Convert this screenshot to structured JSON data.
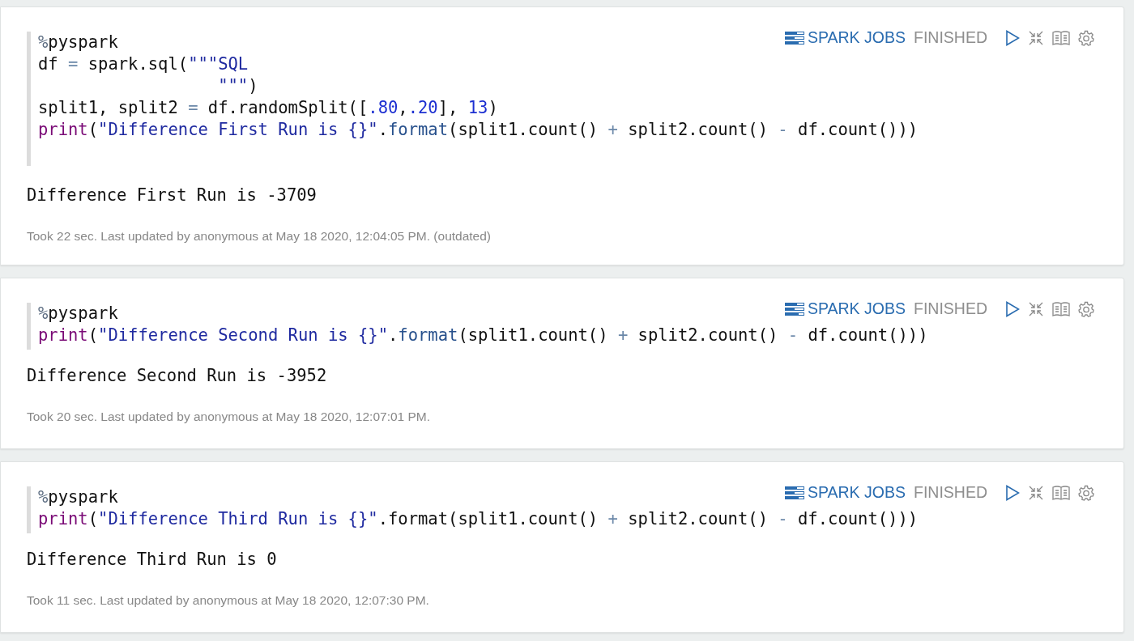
{
  "paragraphs": [
    {
      "toolbar": {
        "jobs_label": "SPARK JOBS",
        "status": "FINISHED"
      },
      "code": [
        [
          {
            "kind": "magic",
            "text": "%"
          },
          {
            "kind": "plain",
            "text": "pyspark"
          }
        ],
        [
          {
            "kind": "plain",
            "text": "df "
          },
          {
            "kind": "operator",
            "text": "="
          },
          {
            "kind": "plain",
            "text": " spark.sql("
          },
          {
            "kind": "string",
            "text": "\"\"\"SQL"
          }
        ],
        [
          {
            "kind": "string",
            "text": "                  \"\"\""
          },
          {
            "kind": "plain",
            "text": ")"
          }
        ],
        [
          {
            "kind": "plain",
            "text": "split1, split2 "
          },
          {
            "kind": "operator",
            "text": "="
          },
          {
            "kind": "plain",
            "text": " df.randomSplit(["
          },
          {
            "kind": "number",
            "text": ".80"
          },
          {
            "kind": "plain",
            "text": ","
          },
          {
            "kind": "number",
            "text": ".20"
          },
          {
            "kind": "plain",
            "text": "], "
          },
          {
            "kind": "number",
            "text": "13"
          },
          {
            "kind": "plain",
            "text": ")"
          }
        ],
        [
          {
            "kind": "keyword",
            "text": "print"
          },
          {
            "kind": "plain",
            "text": "("
          },
          {
            "kind": "string",
            "text": "\"Difference First Run is {}\""
          },
          {
            "kind": "plain",
            "text": "."
          },
          {
            "kind": "method",
            "text": "format"
          },
          {
            "kind": "plain",
            "text": "(split1.count() "
          },
          {
            "kind": "operator",
            "text": "+"
          },
          {
            "kind": "plain",
            "text": " split2.count() "
          },
          {
            "kind": "operator",
            "text": "-"
          },
          {
            "kind": "plain",
            "text": " df.count()))"
          }
        ]
      ],
      "output": "Difference First Run is -3709",
      "footer": "Took 22 sec. Last updated by anonymous at May 18 2020, 12:04:05 PM. (outdated)"
    },
    {
      "toolbar": {
        "jobs_label": "SPARK JOBS",
        "status": "FINISHED"
      },
      "code": [
        [
          {
            "kind": "magic",
            "text": "%"
          },
          {
            "kind": "plain",
            "text": "pyspark"
          }
        ],
        [
          {
            "kind": "keyword",
            "text": "print"
          },
          {
            "kind": "plain",
            "text": "("
          },
          {
            "kind": "string",
            "text": "\"Difference Second Run is {}\""
          },
          {
            "kind": "plain",
            "text": "."
          },
          {
            "kind": "method",
            "text": "format"
          },
          {
            "kind": "plain",
            "text": "(split1.count() "
          },
          {
            "kind": "operator",
            "text": "+"
          },
          {
            "kind": "plain",
            "text": " split2.count() "
          },
          {
            "kind": "operator",
            "text": "-"
          },
          {
            "kind": "plain",
            "text": " df.count()))"
          }
        ]
      ],
      "output": "Difference Second Run is -3952",
      "footer": "Took 20 sec. Last updated by anonymous at May 18 2020, 12:07:01 PM."
    },
    {
      "toolbar": {
        "jobs_label": "SPARK JOBS",
        "status": "FINISHED"
      },
      "code": [
        [
          {
            "kind": "magic",
            "text": "%"
          },
          {
            "kind": "plain",
            "text": "pyspark"
          }
        ],
        [
          {
            "kind": "keyword",
            "text": "print"
          },
          {
            "kind": "plain",
            "text": "("
          },
          {
            "kind": "string",
            "text": "\"Difference Third Run is {}\""
          },
          {
            "kind": "plain",
            "text": ".format(split1.count() "
          },
          {
            "kind": "operator",
            "text": "+"
          },
          {
            "kind": "plain",
            "text": " split2.count() "
          },
          {
            "kind": "operator",
            "text": "-"
          },
          {
            "kind": "plain",
            "text": " df.count()))"
          }
        ]
      ],
      "output": "Difference Third Run is 0",
      "footer": "Took 11 sec. Last updated by anonymous at May 18 2020, 12:07:30 PM."
    }
  ]
}
